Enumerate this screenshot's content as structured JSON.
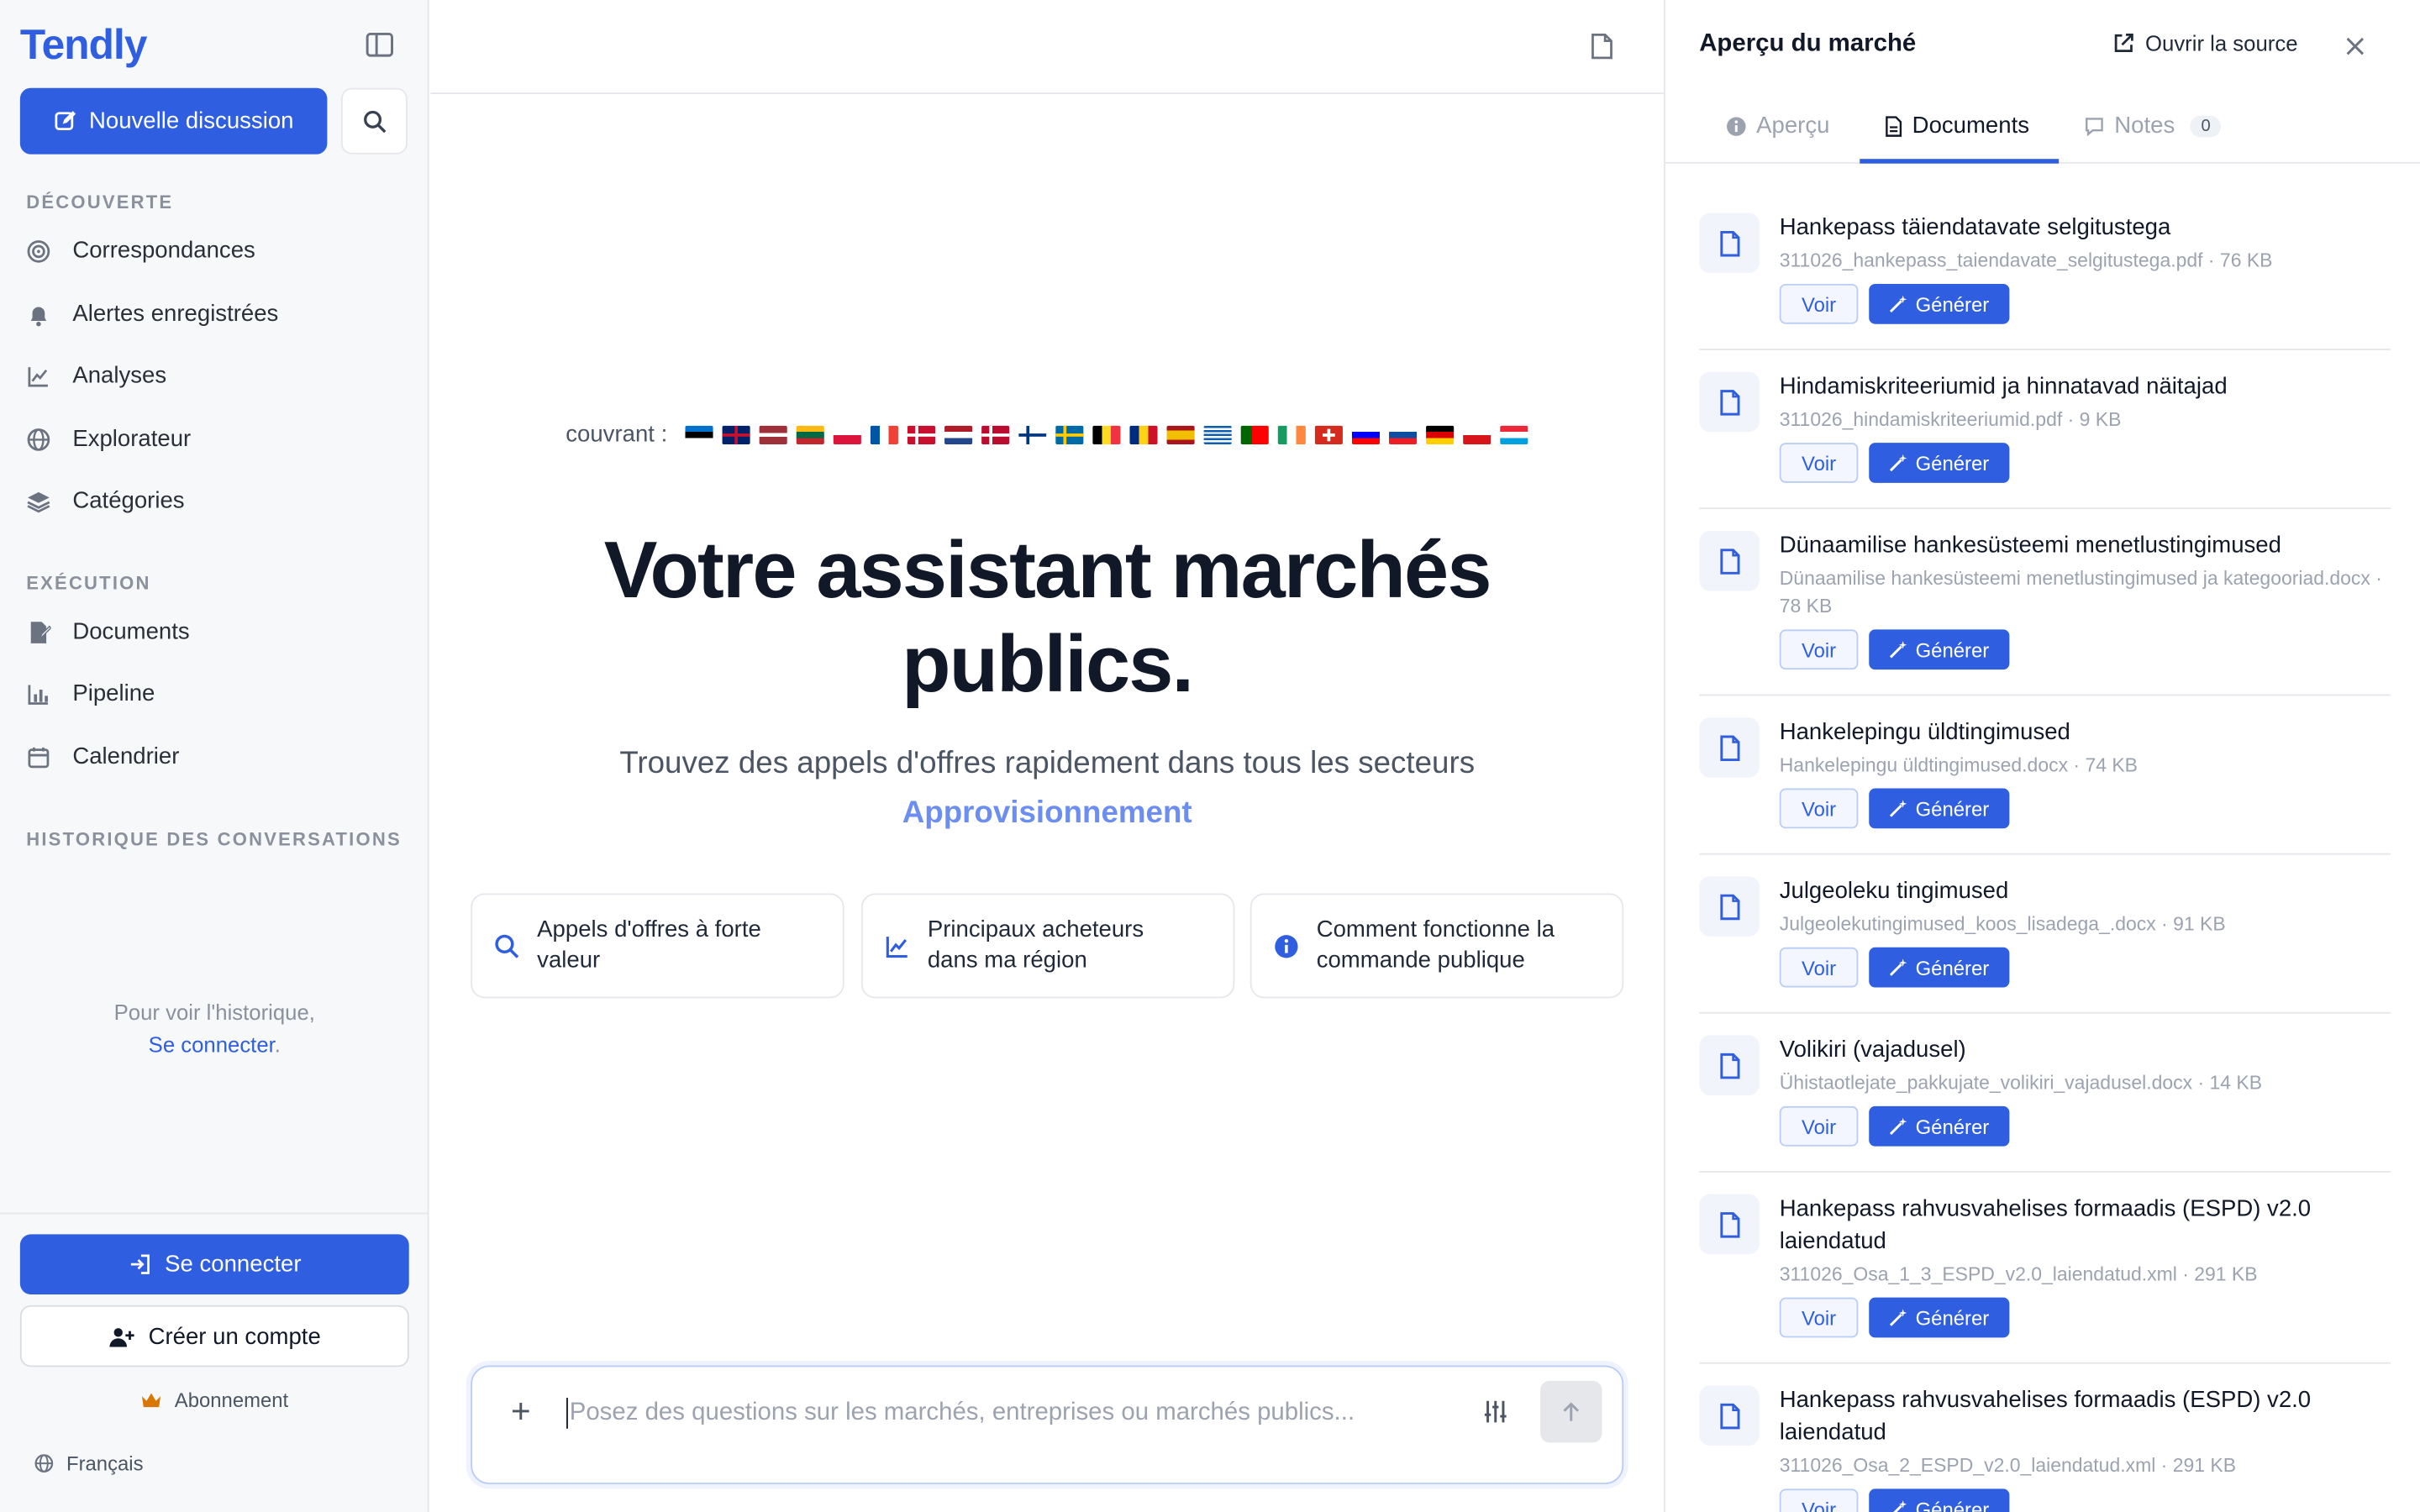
{
  "brand": "Tendly",
  "sidebar": {
    "new_chat": "Nouvelle discussion",
    "sections": {
      "discover": "DÉCOUVERTE",
      "execution": "EXÉCUTION",
      "history": "HISTORIQUE DES CONVERSATIONS"
    },
    "discover_items": [
      {
        "label": "Correspondances",
        "icon": "target-icon"
      },
      {
        "label": "Alertes enregistrées",
        "icon": "bell-icon"
      },
      {
        "label": "Analyses",
        "icon": "chart-line-icon"
      },
      {
        "label": "Explorateur",
        "icon": "globe-icon"
      },
      {
        "label": "Catégories",
        "icon": "layers-icon"
      }
    ],
    "execution_items": [
      {
        "label": "Documents",
        "icon": "file-pen-icon"
      },
      {
        "label": "Pipeline",
        "icon": "bar-chart-icon"
      },
      {
        "label": "Calendrier",
        "icon": "calendar-icon"
      }
    ],
    "history_hint": "Pour voir l'historique,",
    "history_link": "Se connecter",
    "history_suffix": ".",
    "login": "Se connecter",
    "signup": "Créer un compte",
    "subscription": "Abonnement",
    "language": "Français"
  },
  "main": {
    "covering_label": "couvrant :",
    "flags": [
      "EE",
      "GB",
      "LV",
      "LT",
      "PL",
      "FR",
      "DK",
      "NL",
      "NO",
      "FI",
      "SE",
      "BE",
      "RO",
      "ES",
      "GR",
      "PT",
      "IE",
      "CH",
      "SI",
      "SK",
      "DE",
      "CZ",
      "LU"
    ],
    "hero_line1": "Votre assistant marchés",
    "hero_line2": "publics.",
    "subtitle": "Trouvez des appels d'offres rapidement dans tous les secteurs",
    "accent": "Approvisionnement",
    "suggestions": [
      {
        "line1": "Appels d'offres à forte",
        "line2": "valeur",
        "icon": "search-icon"
      },
      {
        "line1": "Principaux acheteurs",
        "line2": "dans ma région",
        "icon": "chart-line-icon"
      },
      {
        "line1": "Comment fonctionne la",
        "line2": "commande publique",
        "icon": "info-icon"
      }
    ],
    "composer_placeholder": "Posez des questions sur les marchés, entreprises ou marchés publics..."
  },
  "panel": {
    "title": "Aperçu du marché",
    "open_source": "Ouvrir la source",
    "tabs": {
      "overview": "Aperçu",
      "documents": "Documents",
      "notes": "Notes",
      "notes_count": "0"
    },
    "view_label": "Voir",
    "generate_label": "Générer",
    "documents": [
      {
        "name": "Hankepass täiendatavate selgitustega",
        "meta": "311026_hankepass_taiendavate_selgitustega.pdf · 76 KB"
      },
      {
        "name": "Hindamiskriteeriumid ja hinnatavad näitajad",
        "meta": "311026_hindamiskriteeriumid.pdf · 9 KB"
      },
      {
        "name": "Dünaamilise hankesüsteemi menetlustingimused",
        "meta": "Dünaamilise hankesüsteemi menetlustingimused ja kategooriad.docx · 78 KB"
      },
      {
        "name": "Hankelepingu üldtingimused",
        "meta": "Hankelepingu üldtingimused.docx · 74 KB"
      },
      {
        "name": "Julgeoleku tingimused",
        "meta": "Julgeolekutingimused_koos_lisadega_.docx · 91 KB"
      },
      {
        "name": "Volikiri (vajadusel)",
        "meta": "Ühistaotlejate_pakkujate_volikiri_vajadusel.docx · 14 KB"
      },
      {
        "name": "Hankepass rahvusvahelises formaadis (ESPD) v2.0 laiendatud",
        "meta": "311026_Osa_1_3_ESPD_v2.0_laiendatud.xml · 291 KB"
      },
      {
        "name": "Hankepass rahvusvahelises formaadis (ESPD) v2.0 laiendatud",
        "meta": "311026_Osa_2_ESPD_v2.0_laiendatud.xml · 291 KB"
      }
    ]
  },
  "colors": {
    "accent": "#2f5fe0",
    "accent_light": "#6b8ef0"
  }
}
